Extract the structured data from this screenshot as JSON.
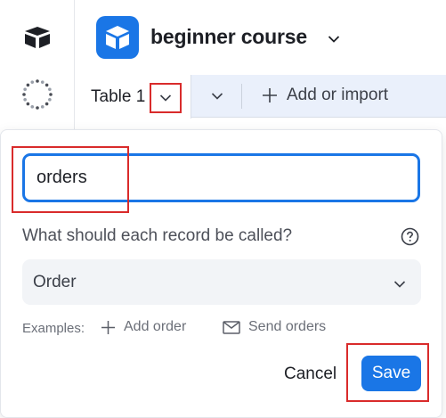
{
  "header": {
    "base_name": "beginner course",
    "accent": "#1a76e6"
  },
  "icons": {
    "rail_logo": "airtable-logo-icon",
    "rail_spinner": "loading-spinner-icon",
    "base_icon": "base-cube-icon",
    "base_chevron": "chevron-down-icon",
    "tab_chevron": "chevron-down-icon",
    "tabs_more": "chevron-down-icon",
    "add_import": "plus-icon",
    "help": "question-circle-icon",
    "select_chevron": "chevron-down-icon",
    "example_add": "plus-icon",
    "example_send": "envelope-icon"
  },
  "tabs": {
    "active_label": "Table 1",
    "add_import_label": "Add or import"
  },
  "popover": {
    "table_name_value": "orders",
    "record_question": "What should each record be called?",
    "record_name_value": "Order",
    "examples_label": "Examples:",
    "example_add_label": "Add order",
    "example_send_label": "Send orders",
    "cancel_label": "Cancel",
    "save_label": "Save"
  },
  "highlight_color": "#d92b2b"
}
